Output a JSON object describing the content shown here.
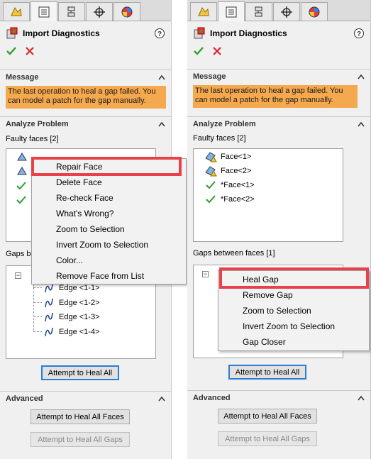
{
  "colors": {
    "message_bg": "#f5a94f",
    "highlight_border": "#e8414b",
    "primary_button_border": "#2d7dd2",
    "ok_green": "#2e9e2e",
    "cancel_red": "#d6262e"
  },
  "tabs": [
    "feature-manager-icon",
    "property-manager-icon",
    "configuration-manager-icon",
    "dimxpert-icon",
    "display-manager-icon"
  ],
  "left": {
    "title": "Import Diagnostics",
    "message_header": "Message",
    "message_text": "The last operation to heal a gap failed. You can model a patch for the gap manually.",
    "analyze_header": "Analyze Problem",
    "faulty_faces_label": "Faulty faces [2]",
    "gaps_label_visible": "Gaps b",
    "context_menu": [
      "Repair Face",
      "Delete Face",
      "Re-check Face",
      "What's Wrong?",
      "Zoom to Selection",
      "Invert Zoom to Selection",
      "Color...",
      "Remove Face from List"
    ],
    "edges": [
      "Edge <1-1>",
      "Edge <1-2>",
      "Edge <1-3>",
      "Edge <1-4>"
    ],
    "heal_all_button": "Attempt to Heal All",
    "advanced_header": "Advanced",
    "heal_faces_button": "Attempt to Heal All Faces",
    "heal_gaps_button": "Attempt to Heal All Gaps"
  },
  "right": {
    "title": "Import Diagnostics",
    "message_header": "Message",
    "message_text": "The last operation to heal a gap failed. You can model a patch for the gap manually.",
    "analyze_header": "Analyze Problem",
    "faulty_faces_label": "Faulty faces [2]",
    "faces": [
      "Face<1>",
      "Face<2>",
      "*Face<1>",
      "*Face<2>"
    ],
    "gaps_label": "Gaps between faces [1]",
    "context_menu": [
      "Heal Gap",
      "Remove Gap",
      "Zoom to Selection",
      "Invert Zoom to Selection",
      "Gap Closer"
    ],
    "heal_all_button": "Attempt to Heal All",
    "advanced_header": "Advanced",
    "heal_faces_button": "Attempt to Heal All Faces",
    "heal_gaps_button": "Attempt to Heal All Gaps"
  }
}
